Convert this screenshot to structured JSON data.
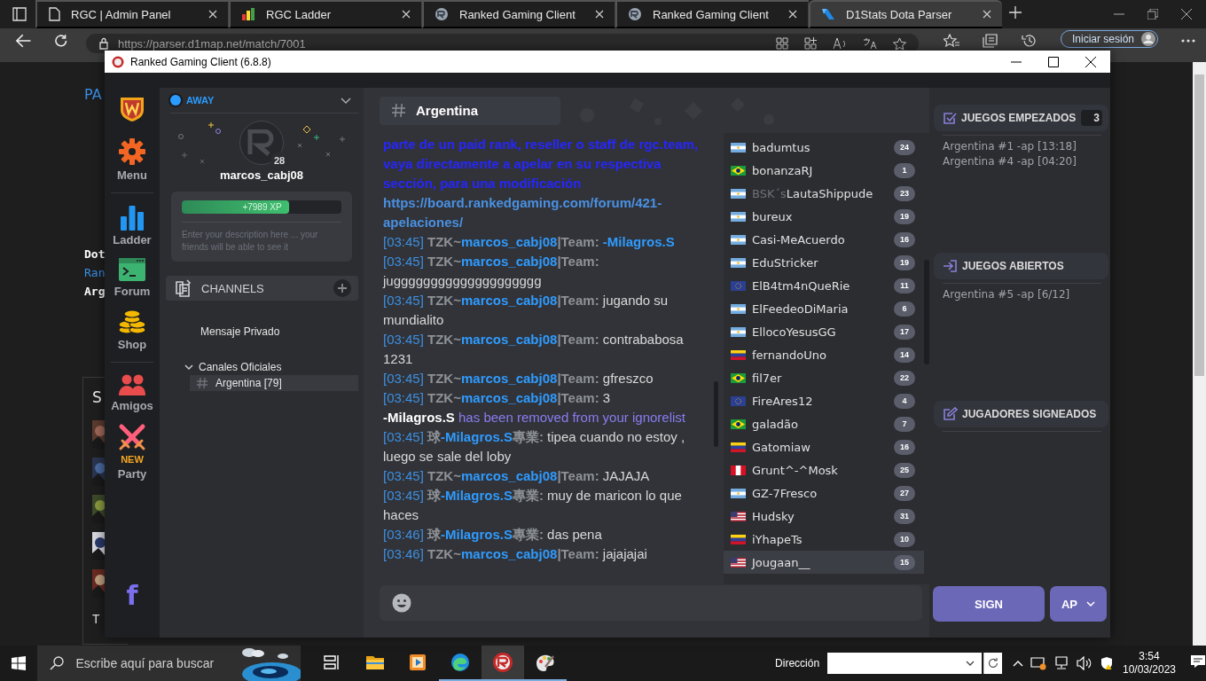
{
  "browser": {
    "tabs": [
      {
        "kind": "page",
        "title": "RGC | Admin Panel",
        "selected": false
      },
      {
        "kind": "bars",
        "title": "RGC Ladder",
        "selected": false
      },
      {
        "kind": "rgc",
        "title": "Ranked Gaming Client",
        "selected": false
      },
      {
        "kind": "rgc",
        "title": "Ranked Gaming Client",
        "selected": false
      },
      {
        "kind": "d1",
        "title": "D1Stats Dota Parser",
        "selected": true
      }
    ],
    "address": "https://parser.d1map.net/match/7001",
    "sign_in": "Iniciar sesión",
    "page": {
      "heading": "PA",
      "lines": [
        {
          "kind": "plain",
          "text": "Dot"
        },
        {
          "kind": "link",
          "text": "Ran"
        },
        {
          "kind": "plain",
          "text": "Arg"
        }
      ],
      "panel_title": "S",
      "panel_footer": "T"
    }
  },
  "app": {
    "title": "Ranked Gaming Client (6.8.8)",
    "nav": [
      {
        "kind": "logo"
      },
      {
        "kind": "gear",
        "label": "Menu"
      },
      {
        "kind": "divider"
      },
      {
        "kind": "ladder",
        "label": "Ladder"
      },
      {
        "kind": "forum",
        "label": "Forum"
      },
      {
        "kind": "shop",
        "label": "Shop"
      },
      {
        "kind": "divider"
      },
      {
        "kind": "friends",
        "label": "Amigos"
      },
      {
        "kind": "party",
        "badge": "NEW",
        "label": "Party"
      }
    ],
    "facebook": "f",
    "profile": {
      "status": "AWAY",
      "level": "28",
      "username": "marcos_cabj08",
      "xp": {
        "label": "+7989 XP",
        "level": 0.67
      },
      "description_placeholder": "Enter your description here ... your friends will be able to see it"
    },
    "channels": {
      "title": "CHANNELS",
      "items": [
        {
          "label": "Mensaje Privado",
          "selected": false
        },
        {
          "label": "Canales Oficiales",
          "selected": false,
          "expanded": true,
          "children": [
            {
              "label": "Argentina [79]",
              "selected": true
            }
          ]
        }
      ]
    },
    "channel_header": {
      "name": "Argentina"
    },
    "messages": [
      {
        "kind": "announce",
        "text": "parte de un paid rank, reseller o staff de rgc.team, vaya directamente a apelar en su respectiva sección, para una modificación"
      },
      {
        "kind": "link",
        "text": "https://board.rankedgaming.com/forum/421-apelaciones/"
      },
      {
        "kind": "chat",
        "time": "[03:45]",
        "prefix": "TZK~",
        "name": "marcos_cabj08",
        "suffix": "|Team:",
        "mention": "-Milagros.S"
      },
      {
        "kind": "chat",
        "time": "[03:45]",
        "prefix": "TZK~",
        "name": "marcos_cabj08",
        "suffix": "|Team:",
        "text": "jugggggggggggggggggggg"
      },
      {
        "kind": "chat",
        "time": "[03:45]",
        "prefix": "TZK~",
        "name": "marcos_cabj08",
        "suffix": "|Team:",
        "text": "jugando su mundialito"
      },
      {
        "kind": "chat",
        "time": "[03:45]",
        "prefix": "TZK~",
        "name": "marcos_cabj08",
        "suffix": "|Team:",
        "text": "contrababosa 1231"
      },
      {
        "kind": "chat",
        "time": "[03:45]",
        "prefix": "TZK~",
        "name": "marcos_cabj08",
        "suffix": "|Team:",
        "text": "gfreszco"
      },
      {
        "kind": "chat",
        "time": "[03:45]",
        "prefix": "TZK~",
        "name": "marcos_cabj08",
        "suffix": "|Team:",
        "text": "3"
      },
      {
        "kind": "system",
        "name": "-Milagros.S",
        "text": "has been removed from your ignorelist"
      },
      {
        "kind": "chat",
        "time": "[03:45]",
        "prefix": "球",
        "name": "-Milagros.S",
        "suffix": "專業:",
        "text": "tipea cuando no estoy , luego se sale del loby"
      },
      {
        "kind": "chat",
        "time": "[03:45]",
        "prefix": "TZK~",
        "name": "marcos_cabj08",
        "suffix": "|Team:",
        "text": "JAJAJA"
      },
      {
        "kind": "chat",
        "time": "[03:45]",
        "prefix": "球",
        "name": "-Milagros.S",
        "suffix": "專業:",
        "text": "muy de maricon lo que haces"
      },
      {
        "kind": "chat",
        "time": "[03:46]",
        "prefix": "球",
        "name": "-Milagros.S",
        "suffix": "專業:",
        "text": "das pena"
      },
      {
        "kind": "chat",
        "time": "[03:46]",
        "prefix": "TZK~",
        "name": "marcos_cabj08",
        "suffix": "|Team:",
        "text": "jajajajai"
      }
    ],
    "users": [
      {
        "kind": "argentina",
        "name": "badumtus",
        "level": "24",
        "selected": false
      },
      {
        "kind": "brazil",
        "name": "bonanzaRJ",
        "level": "1",
        "selected": false
      },
      {
        "kind": "argentina",
        "tag": "BSK´s",
        "name": "LautaShippude",
        "level": "23",
        "selected": false
      },
      {
        "kind": "argentina",
        "name": "bureux",
        "level": "19",
        "selected": false
      },
      {
        "kind": "argentina",
        "name": "Casi-MeAcuerdo",
        "level": "16",
        "selected": false
      },
      {
        "kind": "argentina",
        "name": "EduStricker",
        "level": "19",
        "selected": false
      },
      {
        "kind": "eu",
        "name": "ElB4tm4nQueRie",
        "level": "11",
        "selected": false
      },
      {
        "kind": "argentina",
        "name": "ElFeedeoDiMaria",
        "level": "6",
        "selected": false
      },
      {
        "kind": "argentina",
        "name": "EllocoYesusGG",
        "level": "17",
        "selected": false
      },
      {
        "kind": "venezuela",
        "name": "fernandoUno",
        "level": "14",
        "selected": false
      },
      {
        "kind": "brazil",
        "name": "fil7er",
        "level": "22",
        "selected": false
      },
      {
        "kind": "eu",
        "name": "FireAres12",
        "level": "4",
        "selected": false
      },
      {
        "kind": "brazil",
        "name": "galadão",
        "level": "7",
        "selected": false
      },
      {
        "kind": "venezuela",
        "name": "Gatomiaw",
        "level": "16",
        "selected": false
      },
      {
        "kind": "peru",
        "name": "Grunt^-^Mosk",
        "level": "25",
        "selected": false
      },
      {
        "kind": "argentina",
        "name": "GZ-7Fresco",
        "level": "27",
        "selected": false
      },
      {
        "kind": "usa",
        "name": "Hudsky",
        "level": "31",
        "selected": false
      },
      {
        "kind": "venezuela",
        "name": "iYhapeTs",
        "level": "10",
        "selected": false
      },
      {
        "kind": "usa",
        "name": "Jougaan__",
        "level": "15",
        "selected": true
      }
    ],
    "games": [
      {
        "kind": "started",
        "title": "JUEGOS EMPEZADOS",
        "count": "3",
        "items": [
          "Argentina #1 -ap [13:18]",
          "Argentina #4 -ap [04:20]"
        ]
      },
      {
        "kind": "open",
        "title": "JUEGOS ABIERTOS",
        "items": [
          "Argentina #5 -ap [6/12]"
        ]
      },
      {
        "kind": "signed",
        "title": "JUGADORES SIGNEADOS"
      }
    ],
    "buttons": {
      "sign": "SIGN",
      "ap": "AP"
    }
  },
  "taskbar": {
    "search_placeholder": "Escribe aquí para buscar",
    "apps": [
      {
        "kind": "taskview",
        "selected": false,
        "running": false
      },
      {
        "kind": "folder",
        "selected": false,
        "running": false
      },
      {
        "kind": "media",
        "selected": false,
        "running": false
      },
      {
        "kind": "edge",
        "selected": false,
        "running": true
      },
      {
        "kind": "rgc",
        "selected": true,
        "running": true
      },
      {
        "kind": "paint",
        "selected": false,
        "running": true
      }
    ],
    "address_label": "Dirección",
    "time": "3:54",
    "date": "10/03/2023"
  }
}
